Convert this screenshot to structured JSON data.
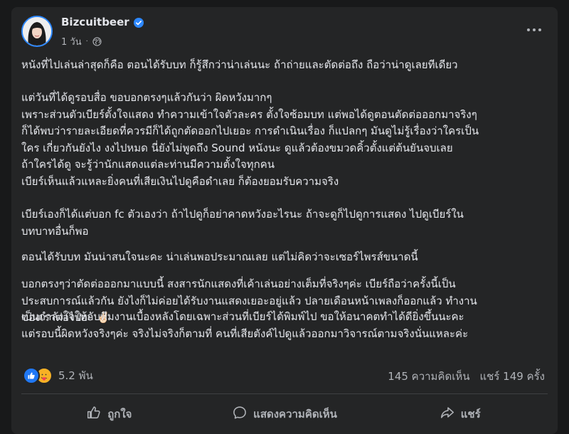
{
  "post": {
    "author": "Bizcuitbeer",
    "time": "1 วัน",
    "separator": "·",
    "paragraphs": [
      "หนังที่ไปเล่นล่าสุดก็คือ ตอนได้รับบท ก็รู้สึกว่าน่าเล่นนะ ถ้าถ่ายและตัดต่อถึง ถือว่าน่าดูเลยทีเดียว",
      "แต่วันที่ได้ดูรอบสื่อ ขอบอกตรงๆแล้วกันว่า ผิดหวังมากๆ\nเพราะส่วนตัวเบียร์ตั้งใจแสดง ทำความเข้าใจตัวละคร ตั้งใจซ้อมบท แต่พอได้ดูตอนตัดต่อออกมาจริงๆ\nก็ได้พบว่ารายละเอียดที่ควรมีก็ได้ถูกตัดออกไปเยอะ การดำเนินเรื่อง ก็แปลกๆ มันดูไม่รู้เรื่องว่าใครเป็น\nใคร เกี่ยวกันยังไง งงไปหมด นี่ยังไม่พูดถึง Sound หนังนะ ดูแล้วต้องขมวดคิ้วตั้งแต่ต้นยันจบเลย",
      "ถ้าใครได้ดู จะรู้ว่านักแสดงแต่ละท่านมีความตั้งใจทุกคน\nเบียร์เห็นแล้วแหละยิ่งคนที่เสียเงินไปดูคือดำเลย ก็ต้องยอมรับความจริง",
      "เบียร์เองก็ได้แต่บอก fc ตัวเองว่า ถ้าไปดูก็อย่าคาดหวังอะไรนะ ถ้าจะดูก็ไปดูการแสดง ไปดูเบียร์ใน\nบทบาทอื่นก็พอ",
      "ตอนได้รับบท มันน่าสนใจนะคะ น่าเล่นพอประมาณเลย แต่ไม่คิดว่าจะเซอร์ไพรส์ขนาดนี้",
      "บอกตรงๆว่าตัดต่อออกมาแบบนี้ สงสารนักแสดงที่เค้าเล่นอย่างเต็มที่จริงๆค่ะ เบียร์ถือว่าครั้งนี้เป็น\nประสบการณ์แล้วกัน ยังไงก็ไม่ค่อยได้รับงานแสดงเยอะอยู่แล้ว ปลายเดือนหน้าเพลงก็ออกแล้ว ทำงาน\nของเราต่อไปฮะ ✌🏻",
      "เป็นกำลังใจให้กับทีมงานเบื้องหลังโดยเฉพาะส่วนที่เบียร์ได้พิมพ์ไป ขอให้อนาคตทำได้ดียิ่งขึ้นนะคะ\nแต่รอบนี้ผิดหวังจริงๆค่ะ จริงไม่จริงก็ตามที่ คนที่เสียตังค์ไปดูแล้วออกมาวิจารณ์ตามจริงนั่นแหละค่ะ"
    ]
  },
  "stats": {
    "reactions": "5.2 พัน",
    "comments": "145 ความคิดเห็น",
    "shares": "แชร์ 149 ครั้ง"
  },
  "actions": {
    "like": "ถูกใจ",
    "comment": "แสดงความคิดเห็น",
    "share": "แชร์"
  },
  "colors": {
    "background": "#18191a",
    "card": "#242526",
    "text": "#e4e6eb",
    "secondary": "#b0b3b8",
    "accent": "#2d88ff"
  },
  "icons": [
    "verified-badge-icon",
    "globe-icon",
    "more-options-icon",
    "like-reaction-icon",
    "care-reaction-icon",
    "thumbs-up-icon",
    "comment-bubble-icon",
    "share-arrow-icon"
  ]
}
